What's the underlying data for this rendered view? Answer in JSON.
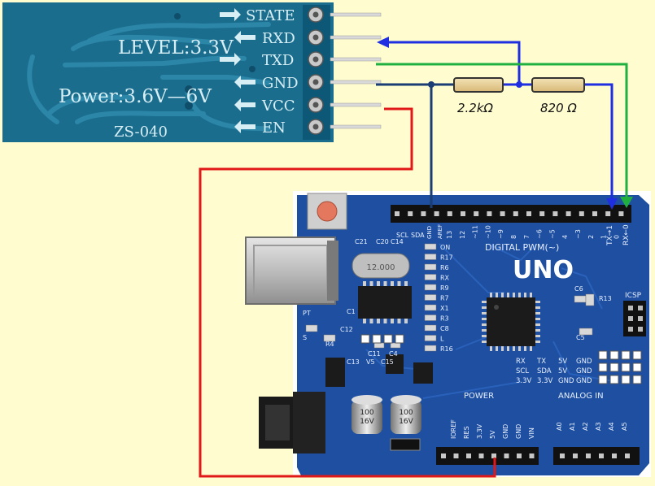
{
  "bt_module": {
    "pins": [
      "STATE",
      "RXD",
      "TXD",
      "GND",
      "VCC",
      "EN"
    ],
    "level_text": "LEVEL:3.3V",
    "power_text": "Power:3.6V—6V",
    "model": "ZS-040",
    "colors": {
      "board": "#1b6d8e",
      "silk": "#d7eef5"
    }
  },
  "resistors": [
    {
      "label": "2.2kΩ"
    },
    {
      "label": "820 Ω"
    }
  ],
  "wires": {
    "colors": {
      "gnd": "#1a3d75",
      "rx_divider": "#1f2ee0",
      "tx": "#20b040",
      "vcc": "#e01818"
    }
  },
  "arduino": {
    "brand": "UNO",
    "digital_pwm": "DIGITAL PWM(~)",
    "tx_rx": [
      "TX→1",
      "RX←0"
    ],
    "gnd_label": "GND",
    "aref": "AREF",
    "scl_sda": [
      "SCL",
      "SDA"
    ],
    "digital_numbers": [
      "13",
      "12",
      "~11",
      "~10",
      "~9",
      "8",
      "7",
      "~6",
      "~5",
      "4",
      "~3",
      "2",
      "1",
      "0"
    ],
    "power_title": "POWER",
    "analog_title": "ANALOG IN",
    "power_pins": [
      "IOREF",
      "RES",
      "3.3V",
      "5V",
      "GND",
      "GND",
      "VIN"
    ],
    "analog_pins": [
      "A0",
      "A1",
      "A2",
      "A3",
      "A4",
      "A5"
    ],
    "icsp": "ICSP",
    "leds": [
      "ON",
      "L",
      "TX",
      "RX"
    ],
    "component_labels": [
      "C21",
      "C20",
      "C14",
      "R17",
      "R6",
      "R8",
      "R9",
      "R7",
      "X1",
      "R3",
      "C8",
      "L",
      "R16",
      "C1",
      "C12",
      "R4",
      "C11",
      "C13",
      "V5",
      "C15",
      "C4",
      "C6",
      "R13",
      "C5",
      "PT",
      "S"
    ],
    "crystal": "12.000",
    "cap_values": [
      "100\n16V",
      "100\n16V"
    ],
    "bottom_header_labels": [
      {
        "row": [
          "RX",
          "TX",
          "5V",
          "GND"
        ]
      },
      {
        "row": [
          "SCL",
          "SDA",
          "5V",
          "GND"
        ]
      },
      {
        "row": [
          "3.3V",
          "3.3V",
          "GND",
          "GND"
        ]
      }
    ],
    "colors": {
      "board": "#1e4fa0",
      "dark": "#12357a",
      "silk": "#e8f0ff"
    }
  }
}
